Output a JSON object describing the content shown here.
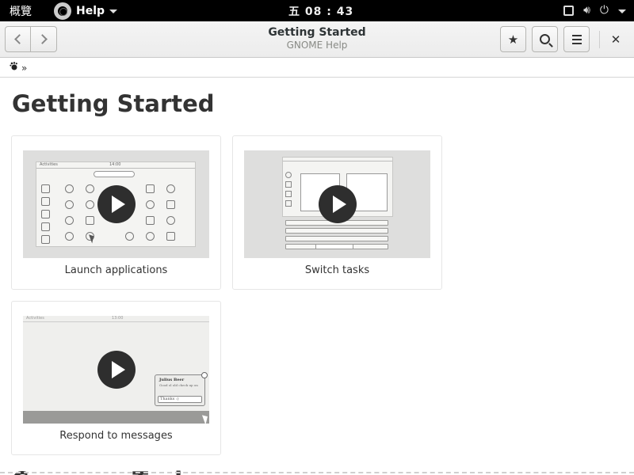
{
  "topbar": {
    "activities": "概覽",
    "app_name": "Help",
    "clock": "五 08 : 43",
    "icons": [
      "window-icon",
      "volume-icon",
      "power-icon",
      "chevron-down-icon"
    ]
  },
  "header": {
    "title": "Getting Started",
    "subtitle": "GNOME Help",
    "buttons": [
      "back",
      "forward",
      "bookmark",
      "search",
      "menu",
      "close"
    ],
    "close_glyph": "✕"
  },
  "breadcrumb": {
    "home_glyph": "🗲",
    "separator": "»"
  },
  "main": {
    "title": "Getting Started",
    "cards": [
      {
        "label": "Launch applications",
        "thumb_title": "Activities",
        "thumb_clock": "14:00"
      },
      {
        "label": "Switch tasks"
      },
      {
        "label": "Respond to messages",
        "thumb_title": "Activities",
        "thumb_clock": "13:00",
        "popup_name": "Julius Beer",
        "popup_text": "Good ol old check up on",
        "popup_reply": "Thanks :)"
      }
    ],
    "next_section": "Common Tasks"
  }
}
